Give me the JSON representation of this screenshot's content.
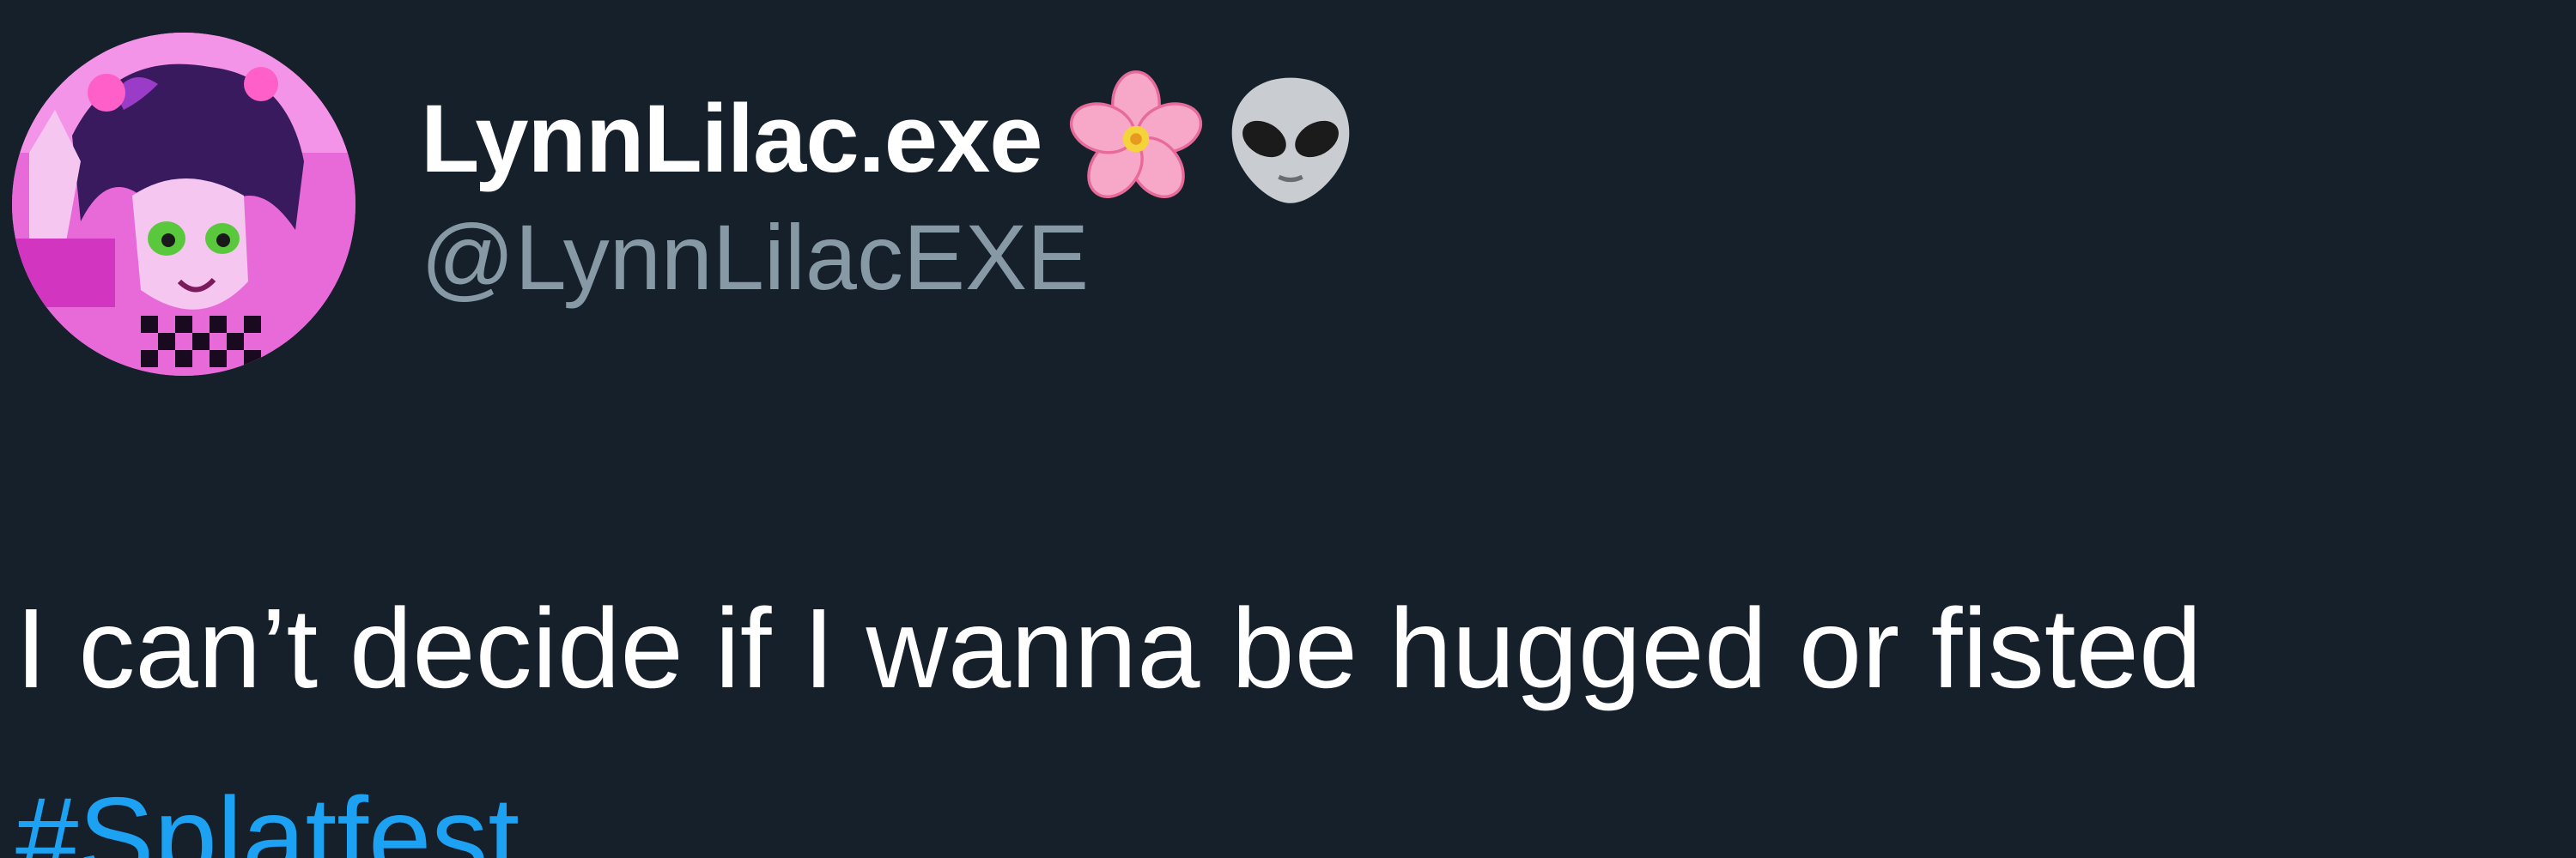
{
  "tweet": {
    "author": {
      "display_name": "LynnLilac.exe",
      "handle": "@LynnLilacEXE",
      "name_emojis": [
        "cherry-blossom-icon",
        "alien-icon"
      ]
    },
    "text": "I can’t decide if I wanna be hugged or fisted",
    "hashtag": "#Splatfest"
  },
  "colors": {
    "background": "#15202b",
    "text": "#ffffff",
    "secondary_text": "#8899a6",
    "link": "#1da1f2"
  }
}
